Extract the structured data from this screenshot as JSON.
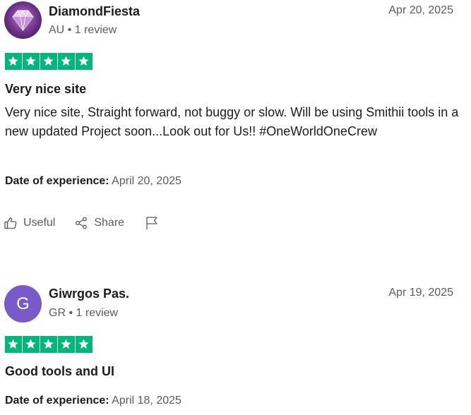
{
  "reviews": [
    {
      "author": "DiamondFiesta",
      "country": "AU",
      "review_count": "1 review",
      "date": "Apr 20, 2025",
      "rating": 5,
      "title": "Very nice site",
      "body": "Very nice site, Straight forward, not buggy or slow. Will be using Smithii tools in a new updated Project soon...Look out for Us!! #OneWorldOneCrew",
      "experience_label": "Date of experience:",
      "experience_date": "April 20, 2025",
      "avatar_icon": "diamond-icon"
    },
    {
      "author": "Giwrgos Pas.",
      "avatar_letter": "G",
      "country": "GR",
      "review_count": "1 review",
      "date": "Apr 19, 2025",
      "rating": 5,
      "title": "Good tools and UI",
      "experience_label": "Date of experience:",
      "experience_date": "April 18, 2025"
    }
  ],
  "actions": {
    "useful_label": "Useful",
    "share_label": "Share"
  },
  "meta_separator": "•",
  "colors": {
    "star_green": "#00b67a",
    "avatar_purple": "#7a59c9",
    "muted_text": "#5c5c5c"
  }
}
